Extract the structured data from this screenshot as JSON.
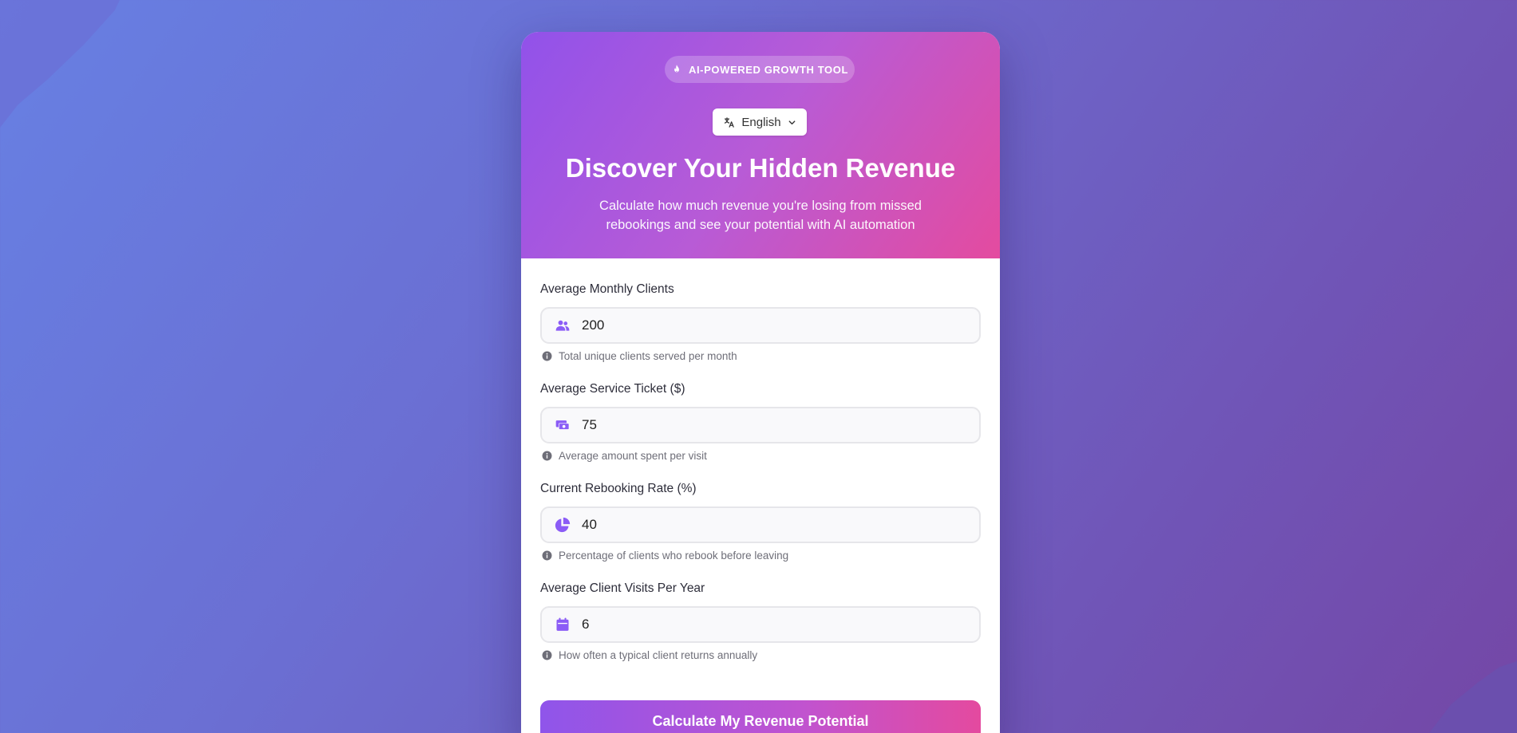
{
  "badge": {
    "label": "AI-POWERED GROWTH TOOL",
    "icon": "flame-icon"
  },
  "language": {
    "selected": "English",
    "icon": "translate-icon"
  },
  "hero": {
    "title": "Discover Your Hidden Revenue",
    "subtitle": "Calculate how much revenue you're losing from missed rebookings and see your potential with AI automation"
  },
  "fields": [
    {
      "label": "Average Monthly Clients",
      "value": "200",
      "icon": "users-icon",
      "hint": "Total unique clients served per month"
    },
    {
      "label": "Average Service Ticket ($)",
      "value": "75",
      "icon": "money-icon",
      "hint": "Average amount spent per visit"
    },
    {
      "label": "Current Rebooking Rate (%)",
      "value": "40",
      "icon": "pie-chart-icon",
      "hint": "Percentage of clients who rebook before leaving"
    },
    {
      "label": "Average Client Visits Per Year",
      "value": "6",
      "icon": "calendar-icon",
      "hint": "How often a typical client returns annually"
    }
  ],
  "cta": {
    "label": "Calculate My Revenue Potential"
  },
  "colors": {
    "accent": "#8b5cf6",
    "gradient_start": "#9152ea",
    "gradient_end": "#e44b9f",
    "hint_icon": "#6e6e78"
  }
}
